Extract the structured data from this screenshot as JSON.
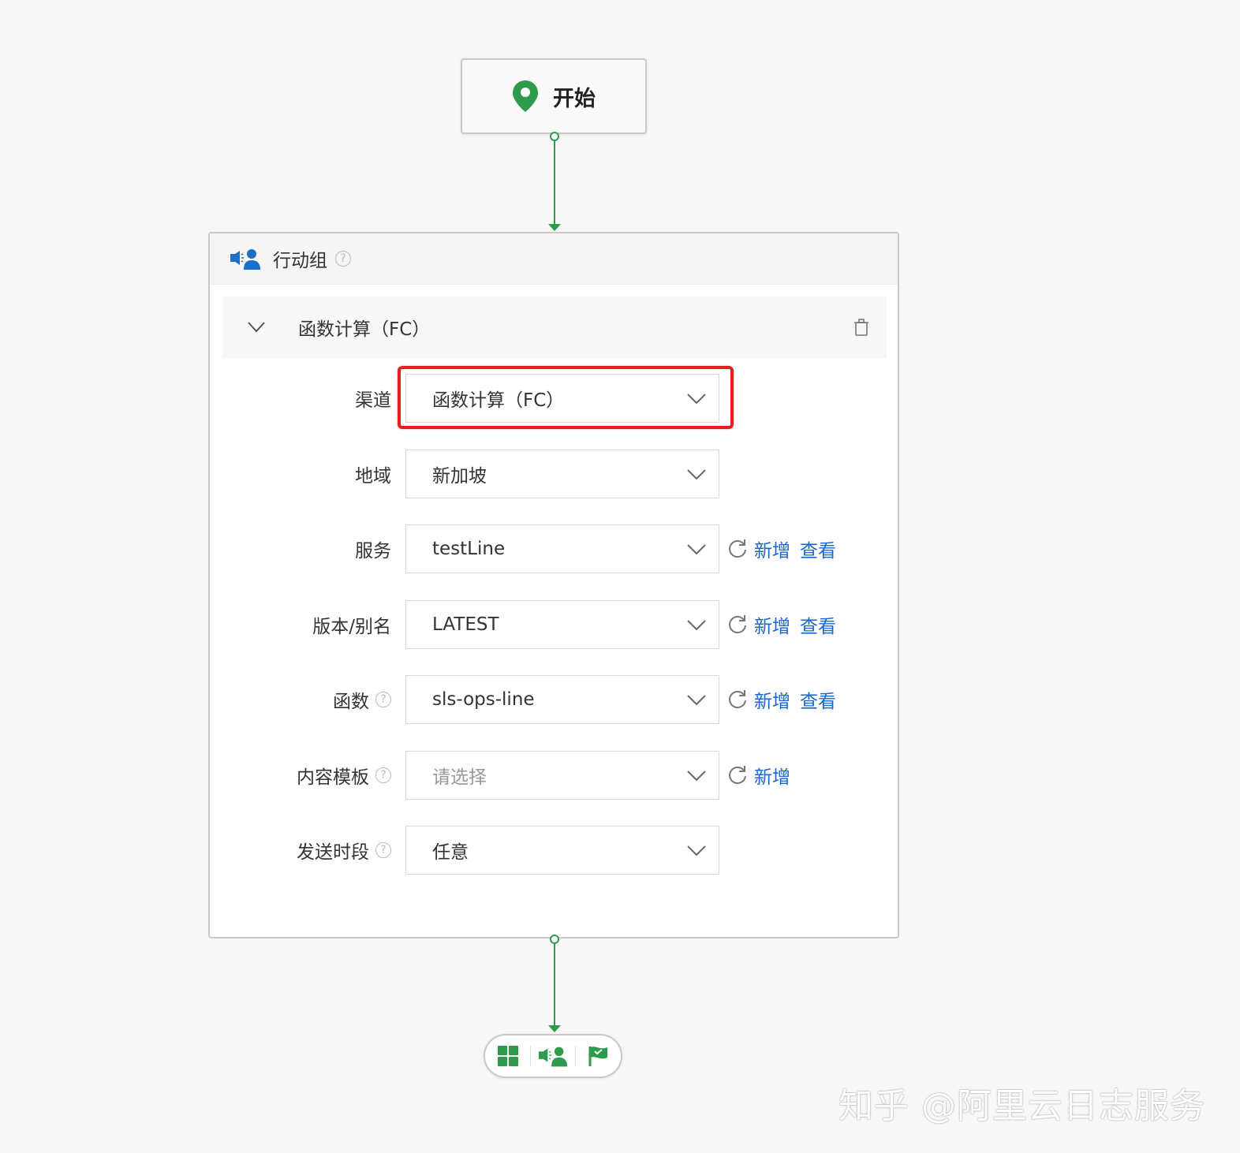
{
  "start_node": {
    "label": "开始",
    "icon": "location-pin-icon"
  },
  "action_group": {
    "title": "行动组",
    "section": {
      "title": "函数计算（FC）",
      "expanded": true
    },
    "fields": [
      {
        "label": "渠道",
        "value": "函数计算（FC）",
        "has_help": false,
        "highlighted": true,
        "actions": []
      },
      {
        "label": "地域",
        "value": "新加坡",
        "has_help": false,
        "actions": []
      },
      {
        "label": "服务",
        "value": "testLine",
        "has_help": false,
        "actions": [
          "新增",
          "查看"
        ]
      },
      {
        "label": "版本/别名",
        "value": "LATEST",
        "has_help": false,
        "actions": [
          "新增",
          "查看"
        ]
      },
      {
        "label": "函数",
        "value": "sls-ops-line",
        "has_help": true,
        "actions": [
          "新增",
          "查看"
        ]
      },
      {
        "label": "内容模板",
        "value": "",
        "placeholder": "请选择",
        "has_help": true,
        "actions": [
          "新增"
        ]
      },
      {
        "label": "发送时段",
        "value": "任意",
        "has_help": true,
        "actions": []
      }
    ]
  },
  "help_glyph": "?",
  "toolbar": {
    "items": [
      "grid-icon",
      "action-group-icon",
      "end-flag-icon"
    ]
  },
  "colors": {
    "accent_green": "#2e9a4b",
    "link_blue": "#1766d4",
    "highlight_red": "#e81d1d",
    "icon_blue": "#1a6fc9"
  },
  "watermark": "知乎 @阿里云日志服务"
}
